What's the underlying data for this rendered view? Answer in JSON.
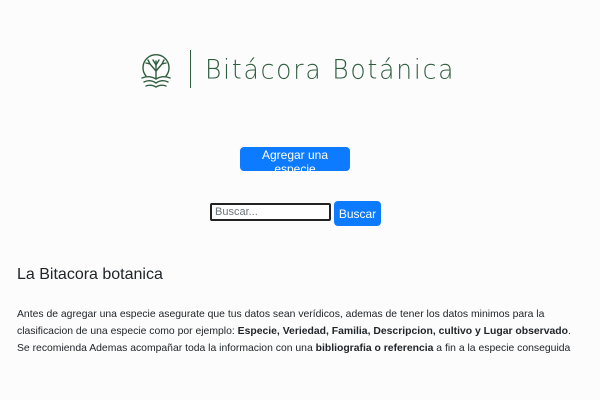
{
  "brand": {
    "name": "Bitácora Botánica",
    "color": "#2f5d3f",
    "icon": "plant-book-icon"
  },
  "actions": {
    "add_species_label": "Agregar una especie",
    "search_placeholder": "Buscar...",
    "search_value": "",
    "search_button_label": "Buscar",
    "primary_color": "#0d7bff"
  },
  "info": {
    "title": "La Bitacora botanica",
    "p1": "Antes de agregar una especie asegurate que tus datos sean verídicos, ademas de tener los datos minimos para la clasificacion de una especie como por ejemplo: ",
    "bold1": "Especie, Veriedad, Familia, Descripcion, cultivo y Lugar observado",
    "p2": ". Se recomienda Ademas acompañar toda la informacion con una ",
    "bold2": "bibliografia o referencia",
    "p3": " a fin a la especie conseguida"
  }
}
